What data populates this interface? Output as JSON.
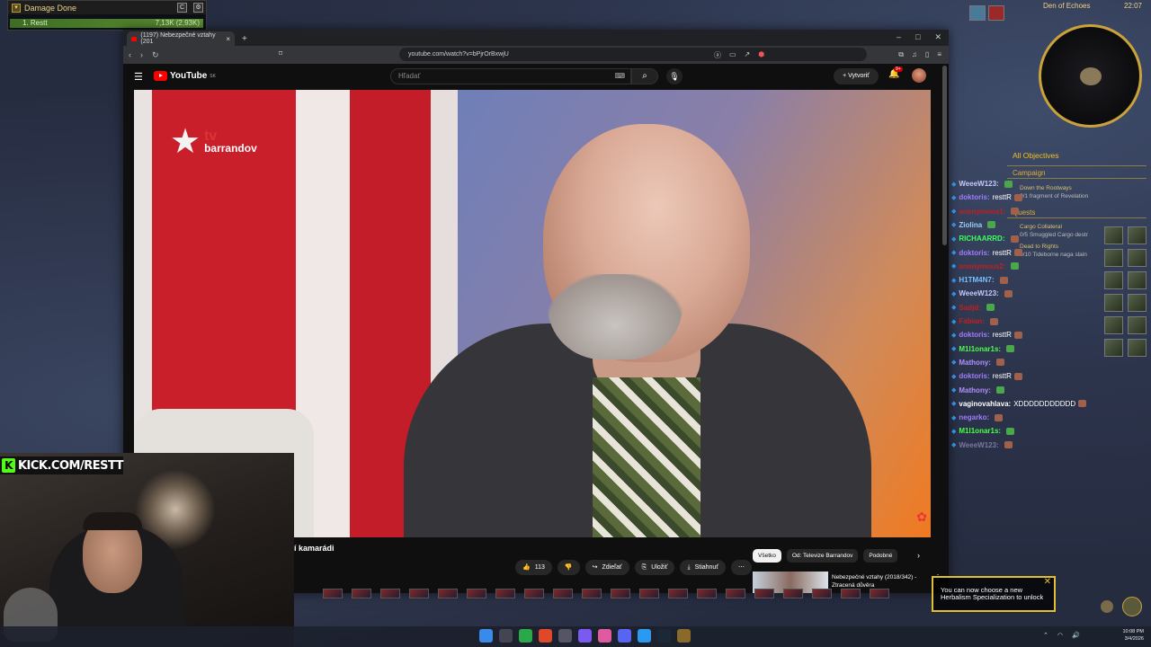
{
  "damage_meter": {
    "title": "Damage Done",
    "row_label": "1. Restt",
    "row_value": "7,13K (2,93K)"
  },
  "browser": {
    "tab_title": "(1197) Nebezpečné vztahy (201",
    "url": "youtube.com/watch?v=bPjrOrBxwjU",
    "youtube": {
      "logo": "YouTube",
      "region": "SK",
      "search_placeholder": "Hľadať",
      "create_label": "Vytvoriť",
      "notifications": "9+"
    },
    "video": {
      "channel_logo_line1": "tv",
      "channel_logo_line2": "barrandov"
    },
    "title_fragment": "í kamarádi",
    "actions": {
      "likes": "113",
      "share": "Zdieľať",
      "save": "Uložiť",
      "download": "Stiahnuť"
    },
    "chips": [
      "Všetko",
      "Od: Televize Barrandov",
      "Podobné"
    ],
    "recommendation": {
      "title": "Nebezpečné vztahy (2018/342) - Ztracená důvěra"
    }
  },
  "webcam": {
    "banner": "KICK.COM/RESTT"
  },
  "chat": [
    {
      "user": "WeeeW123:",
      "text": "",
      "color": "#c8c8ff"
    },
    {
      "user": "doktoris:",
      "text": "resttR",
      "color": "#a07cff"
    },
    {
      "user": "anonymous1:",
      "text": "",
      "color": "#c02020"
    },
    {
      "user": "Ziolina",
      "text": "",
      "color": "#9ad0ff"
    },
    {
      "user": "RICHAARRD:",
      "text": "",
      "color": "#3dff60"
    },
    {
      "user": "doktoris:",
      "text": "resttR",
      "color": "#a07cff"
    },
    {
      "user": "anonymous2:",
      "text": "",
      "color": "#c02020"
    },
    {
      "user": "H1TM4N7:",
      "text": "",
      "color": "#7ac0ff"
    },
    {
      "user": "WeeeW123:",
      "text": "",
      "color": "#c8c8ff"
    },
    {
      "user": "Sadjd:",
      "text": "",
      "color": "#c02020"
    },
    {
      "user": "Fabian:",
      "text": "",
      "color": "#c02020"
    },
    {
      "user": "doktoris:",
      "text": "resttR",
      "color": "#a07cff"
    },
    {
      "user": "M1l1onar1s:",
      "text": "",
      "color": "#4aff4a"
    },
    {
      "user": "Mathony:",
      "text": "",
      "color": "#b090ff"
    },
    {
      "user": "doktoris:",
      "text": "resttR",
      "color": "#a07cff"
    },
    {
      "user": "Mathony:",
      "text": "",
      "color": "#b090ff"
    },
    {
      "user": "vaginovahlava:",
      "text": "XDDDDDDDDDDD",
      "color": "#ffffff"
    },
    {
      "user": "negarko:",
      "text": "",
      "color": "#a07cff"
    },
    {
      "user": "M1l1onar1s:",
      "text": "",
      "color": "#4aff4a"
    },
    {
      "user": "WeeeW123:",
      "text": "",
      "color": "#7878a0"
    }
  ],
  "objectives": {
    "header": "All Objectives",
    "campaign": "Campaign",
    "campaign_quest": "Down the Rootways",
    "campaign_task": "0/1 fragment of Revelation",
    "quests": "Quests",
    "q1": "Cargo Collateral",
    "q1_task": "0/5 Smuggled Cargo destr",
    "q2": "Dead to Rights",
    "q2_task": "0/10 Tideborne naga slain"
  },
  "wow": {
    "zone": "Den of Echoes",
    "time": "22:07"
  },
  "notice": "You can now choose a new Herbalism Specialization to unlock",
  "taskbar": {
    "time": "10:08 PM",
    "date": "3/4/2026"
  }
}
